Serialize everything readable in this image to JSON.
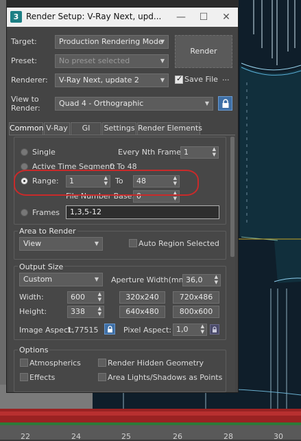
{
  "dialog": {
    "title": "Render Setup: V-Ray Next, upd...",
    "app_icon": "3",
    "controls": {
      "minimize": "—",
      "maximize": "☐",
      "close": "✕"
    }
  },
  "target": {
    "label": "Target:",
    "value": "Production Rendering Mode"
  },
  "preset": {
    "label": "Preset:",
    "value": "No preset selected"
  },
  "renderer": {
    "label": "Renderer:",
    "value": "V-Ray Next, update 2"
  },
  "view": {
    "label_line1": "View to",
    "label_line2": "Render:",
    "value": "Quad 4 - Orthographic"
  },
  "render_button": "Render",
  "save_file": {
    "label": "Save File",
    "checked": true,
    "more": "..."
  },
  "tabs": [
    {
      "label": "Common",
      "active": true
    },
    {
      "label": "V-Ray",
      "active": false
    },
    {
      "label": "GI",
      "active": false
    },
    {
      "label": "Settings",
      "active": false
    },
    {
      "label": "Render Elements",
      "active": false
    }
  ],
  "time_output": {
    "single": "Single",
    "every_nth_label": "Every Nth Frame:",
    "every_nth_value": "1",
    "active_segment": "Active Time Segment:",
    "active_segment_value": "0 To 48",
    "range": "Range:",
    "range_start": "1",
    "range_to": "To",
    "range_end": "48",
    "file_number_base_label": "File Number Base:",
    "file_number_base_value": "0",
    "frames": "Frames",
    "frames_value": "1,3,5-12",
    "selected": "range"
  },
  "area_to_render": {
    "title": "Area to Render",
    "value": "View",
    "auto_region": "Auto Region Selected"
  },
  "output_size": {
    "title": "Output Size",
    "preset": "Custom",
    "aperture_label": "Aperture Width(mm):",
    "aperture_value": "36,0",
    "width_label": "Width:",
    "width_value": "600",
    "height_label": "Height:",
    "height_value": "338",
    "presets": [
      "320x240",
      "720x486",
      "640x480",
      "800x600"
    ],
    "image_aspect_label": "Image Aspect:",
    "image_aspect_value": "1,77515",
    "pixel_aspect_label": "Pixel Aspect:",
    "pixel_aspect_value": "1,0"
  },
  "options": {
    "title": "Options",
    "atmospherics": "Atmospherics",
    "render_hidden": "Render Hidden Geometry",
    "effects": "Effects",
    "area_lights": "Area Lights/Shadows as Points"
  },
  "timeline": {
    "ticks": [
      "22",
      "24",
      "25",
      "26",
      "28",
      "30",
      "32"
    ]
  },
  "colors": {
    "highlight": "#c92a2a",
    "accent": "#3e6fa6",
    "dialog_bg": "#444444"
  },
  "icons": {
    "lock": "lock-icon",
    "spinner": "spinner-arrows-icon",
    "dropdown": "chevron-down-icon"
  }
}
